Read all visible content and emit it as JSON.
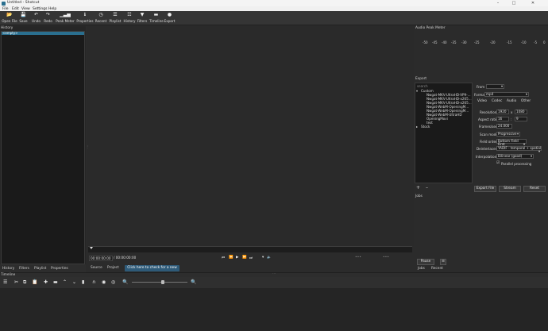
{
  "window": {
    "title": "Untitled - Shotcut"
  },
  "menu": [
    "File",
    "Edit",
    "View",
    "Settings",
    "Help"
  ],
  "toolbar": [
    {
      "label": "Open File",
      "icon": "open-file-icon",
      "glyph": "📂"
    },
    {
      "label": "Save",
      "icon": "save-icon",
      "glyph": "💾"
    },
    {
      "label": "Undo",
      "icon": "undo-icon",
      "glyph": "↶"
    },
    {
      "label": "Redo",
      "icon": "redo-icon",
      "glyph": "↷"
    },
    {
      "label": "Peak Meter",
      "icon": "peak-meter-icon",
      "glyph": "▁▃▅"
    },
    {
      "label": "Properties",
      "icon": "properties-icon",
      "glyph": "ℹ"
    },
    {
      "label": "Recent",
      "icon": "recent-icon",
      "glyph": "◷"
    },
    {
      "label": "Playlist",
      "icon": "playlist-icon",
      "glyph": "☰"
    },
    {
      "label": "History",
      "icon": "history-icon",
      "glyph": "☷"
    },
    {
      "label": "Filters",
      "icon": "filters-icon",
      "glyph": "▼"
    },
    {
      "label": "Timeline",
      "icon": "timeline-icon",
      "glyph": "▬"
    },
    {
      "label": "Export",
      "icon": "export-icon",
      "glyph": "●"
    }
  ],
  "history": {
    "title": "History",
    "items": [
      "<empty>"
    ]
  },
  "left_tabs": [
    "History",
    "Filters",
    "Playlist",
    "Properties"
  ],
  "player": {
    "position": "00:00:00:00",
    "duration": "/ 00:00:00:00",
    "tabs": [
      "Source",
      "Project"
    ],
    "notice": "Click here to check for a new vers..."
  },
  "audio_meter": {
    "title": "Audio Peak Meter",
    "scale": [
      "-50",
      "-45",
      "-40",
      "-35",
      "-30",
      "-25",
      "-20",
      "-15",
      "-10",
      "-5",
      "0"
    ]
  },
  "export": {
    "title": "Export",
    "search_placeholder": "search",
    "presets": [
      "Custom",
      "Nwgat-MKV-UltraHD-VP9-...",
      "Nwgat-MKV-UltraHD-x265...",
      "Nwgat-MKV-UltraHD-x265...",
      "Nwgat-WebM-OpeningM...",
      "Nwgat-WebM-OpeningM...",
      "Nwgat-WebM-UltraHD",
      "OpeningMovi",
      "test",
      "Stock"
    ],
    "from_label": "From",
    "format_label": "Format",
    "format_value": "mp4",
    "tabs": [
      "Video",
      "Codec",
      "Audio",
      "Other"
    ],
    "resolution_label": "Resolution",
    "res_w": "1920",
    "res_x": "x",
    "res_h": "1080",
    "aspect_label": "Aspect ratio",
    "aspect_w": "16",
    "aspect_colon": ":",
    "aspect_h": "9",
    "fps_label": "Frames/sec",
    "fps_value": "24.000",
    "scan_label": "Scan mode",
    "scan_value": "Progressive",
    "field_label": "Field order",
    "field_value": "Bottom Field First",
    "deint_label": "Deinterlacer",
    "deint_value": "YADIF - temporal + spatial",
    "interp_label": "Interpolation",
    "interp_value": "Bilinear (good)",
    "parallel_label": "Parallel processing",
    "buttons": [
      "Export File",
      "Stream",
      "Reset"
    ]
  },
  "jobs": {
    "title": "Jobs",
    "pause_label": "Pause",
    "tabs": [
      "Jobs",
      "Recent"
    ]
  },
  "timeline": {
    "title": "Timeline"
  }
}
